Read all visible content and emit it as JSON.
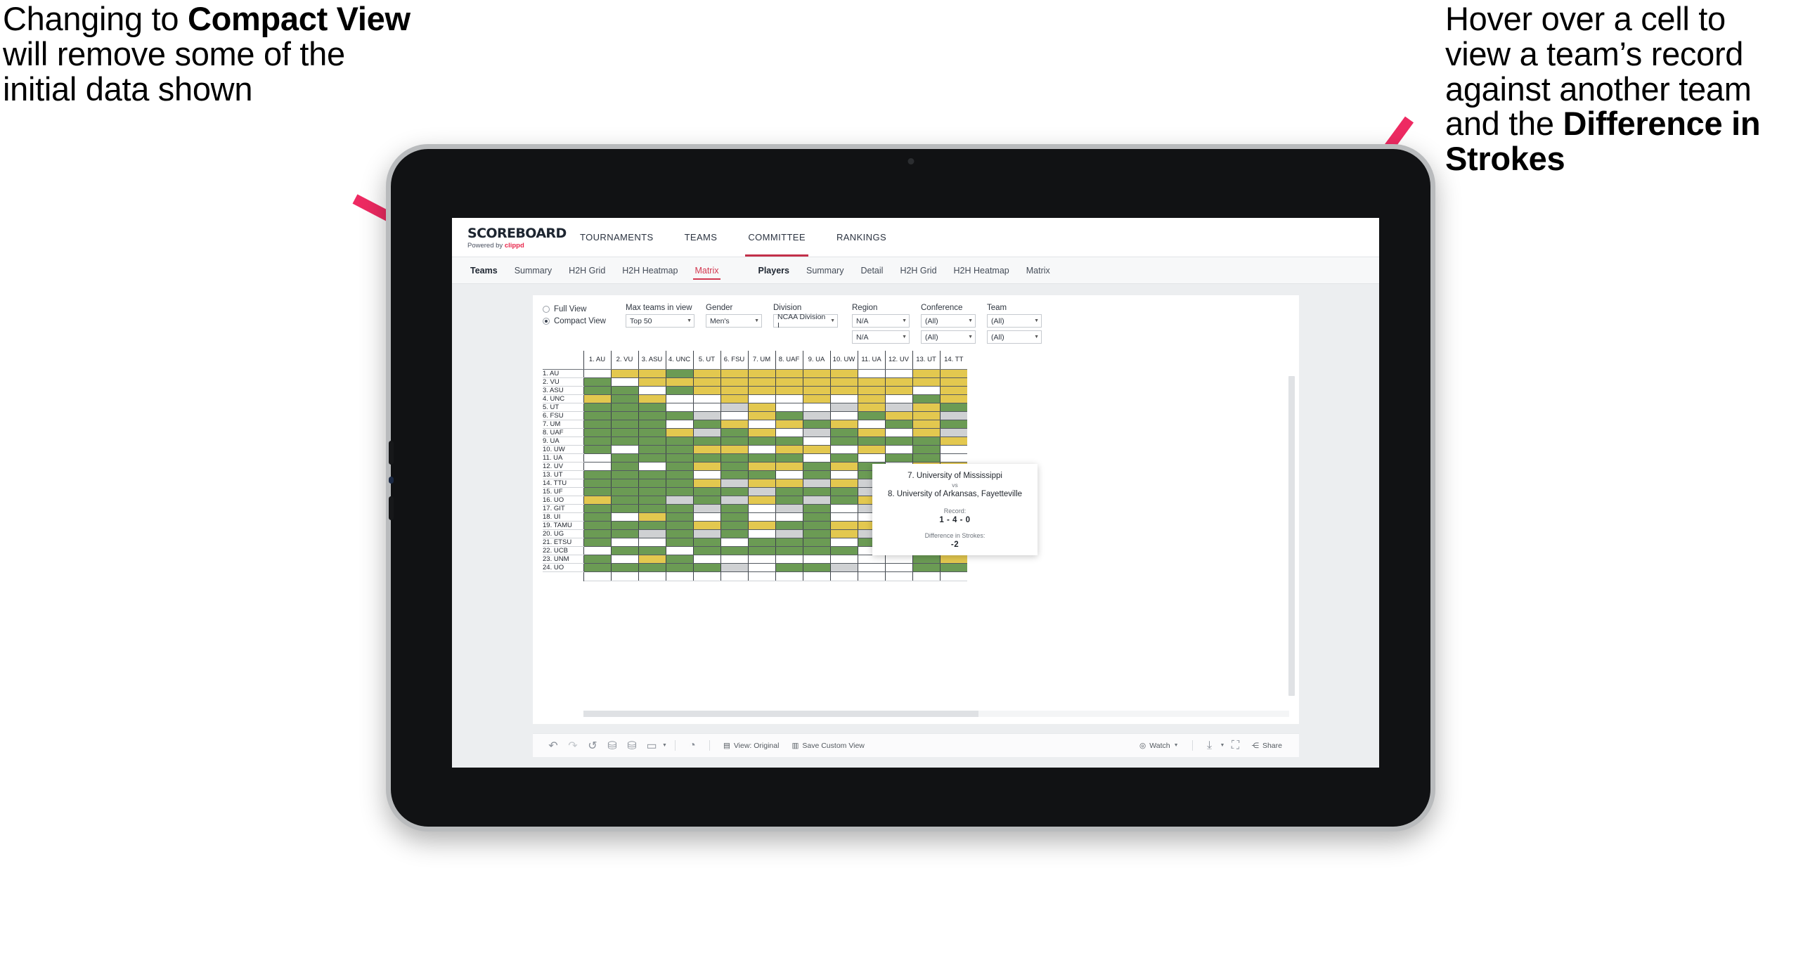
{
  "annotations": {
    "left": {
      "part1": "Changing to ",
      "bold": "Compact View",
      "part2": " will remove some of the initial data shown"
    },
    "right": {
      "part1": "Hover over a cell to view a team’s record against another team and the ",
      "bold": "Difference in Strokes",
      "part2": ""
    },
    "arrow_color": "#ee2a62"
  },
  "app": {
    "brand": {
      "title": "SCOREBOARD",
      "powered_prefix": "Powered by ",
      "powered_name": "clippd"
    },
    "topnav": [
      {
        "label": "TOURNAMENTS",
        "active": false
      },
      {
        "label": "TEAMS",
        "active": false
      },
      {
        "label": "COMMITTEE",
        "active": true
      },
      {
        "label": "RANKINGS",
        "active": false
      }
    ],
    "subnav": {
      "teams_label": "Teams",
      "teams_items": [
        {
          "label": "Summary",
          "active": false
        },
        {
          "label": "H2H Grid",
          "active": false
        },
        {
          "label": "H2H Heatmap",
          "active": false
        },
        {
          "label": "Matrix",
          "active": true
        }
      ],
      "players_label": "Players",
      "players_items": [
        {
          "label": "Summary",
          "active": false
        },
        {
          "label": "Detail",
          "active": false
        },
        {
          "label": "H2H Grid",
          "active": false
        },
        {
          "label": "H2H Heatmap",
          "active": false
        },
        {
          "label": "Matrix",
          "active": false
        }
      ]
    },
    "filters": {
      "view_options": [
        {
          "label": "Full View",
          "selected": false
        },
        {
          "label": "Compact View",
          "selected": true
        }
      ],
      "max_teams": {
        "label": "Max teams in view",
        "value": "Top 50"
      },
      "gender": {
        "label": "Gender",
        "value": "Men's"
      },
      "division": {
        "label": "Division",
        "value": "NCAA Division I"
      },
      "region": {
        "label": "Region",
        "value1": "N/A",
        "value2": "N/A"
      },
      "conference": {
        "label": "Conference",
        "value1": "(All)",
        "value2": "(All)"
      },
      "team": {
        "label": "Team",
        "value1": "(All)",
        "value2": "(All)"
      }
    },
    "tooltip": {
      "team_a": "7. University of Mississippi",
      "vs": "vs",
      "team_b": "8. University of Arkansas, Fayetteville",
      "record_label": "Record:",
      "record_value": "1 - 4 - 0",
      "diff_label": "Difference in Strokes:",
      "diff_value": "-2"
    },
    "toolbar": {
      "icons": [
        {
          "name": "undo-icon",
          "glyph": "↶",
          "dim": false
        },
        {
          "name": "redo-icon",
          "glyph": "↷",
          "dim": true
        },
        {
          "name": "revert-icon",
          "glyph": "↺",
          "dim": false
        },
        {
          "name": "refresh-data-icon",
          "glyph": "⛁",
          "dim": false
        },
        {
          "name": "pause-refresh-icon",
          "glyph": "⛁",
          "dim": false
        },
        {
          "name": "highlight-icon",
          "glyph": "▭",
          "dim": false
        }
      ],
      "clock_icon": "◴",
      "view_original_label": "View: Original",
      "save_custom_view_label": "Save Custom View",
      "watch_label": "Watch",
      "share_label": "Share"
    }
  },
  "chart_data": {
    "type": "heatmap",
    "title": "Head-to-Head Team Matrix",
    "legend": {
      "win": "#6b9b54",
      "loss": "#e3c84f",
      "tie": "#cfd1d3",
      "none": "#ffffff"
    },
    "columns": [
      "1. AU",
      "2. VU",
      "3. ASU",
      "4. UNC",
      "5. UT",
      "6. FSU",
      "7. UM",
      "8. UAF",
      "9. UA",
      "10. UW",
      "11. UA",
      "12. UV",
      "13. UT",
      "14. TT"
    ],
    "rows": [
      "1. AU",
      "2. VU",
      "3. ASU",
      "4. UNC",
      "5. UT",
      "6. FSU",
      "7. UM",
      "8. UAF",
      "9. UA",
      "10. UW",
      "11. UA",
      "12. UV",
      "13. UT",
      "14. TTU",
      "15. UF",
      "16. UO",
      "17. GIT",
      "18. UI",
      "19. TAMU",
      "20. UG",
      "21. ETSU",
      "22. UCB",
      "23. UNM",
      "24. UO"
    ],
    "cells": [
      [
        "w",
        "y",
        "y",
        "g",
        "y",
        "y",
        "y",
        "y",
        "y",
        "y",
        "w",
        "w",
        "y",
        "y"
      ],
      [
        "g",
        "w",
        "y",
        "y",
        "y",
        "y",
        "y",
        "y",
        "y",
        "y",
        "y",
        "y",
        "y",
        "y"
      ],
      [
        "g",
        "g",
        "w",
        "g",
        "y",
        "y",
        "y",
        "y",
        "y",
        "y",
        "y",
        "y",
        "w",
        "y"
      ],
      [
        "y",
        "g",
        "y",
        "w",
        "w",
        "y",
        "w",
        "w",
        "y",
        "w",
        "y",
        "w",
        "g",
        "y"
      ],
      [
        "g",
        "g",
        "g",
        "w",
        "w",
        "s",
        "y",
        "w",
        "w",
        "s",
        "y",
        "s",
        "y",
        "g"
      ],
      [
        "g",
        "g",
        "g",
        "g",
        "s",
        "w",
        "y",
        "g",
        "s",
        "w",
        "g",
        "y",
        "y",
        "s"
      ],
      [
        "g",
        "g",
        "g",
        "w",
        "g",
        "y",
        "w",
        "y",
        "g",
        "y",
        "w",
        "g",
        "y",
        "g"
      ],
      [
        "g",
        "g",
        "g",
        "y",
        "s",
        "g",
        "y",
        "w",
        "s",
        "g",
        "y",
        "w",
        "y",
        "s"
      ],
      [
        "g",
        "g",
        "g",
        "g",
        "g",
        "g",
        "g",
        "g",
        "w",
        "g",
        "g",
        "g",
        "g",
        "y"
      ],
      [
        "g",
        "w",
        "g",
        "g",
        "y",
        "y",
        "w",
        "y",
        "y",
        "w",
        "y",
        "w",
        "g",
        "w"
      ],
      [
        "w",
        "g",
        "g",
        "g",
        "g",
        "g",
        "g",
        "g",
        "w",
        "g",
        "w",
        "g",
        "g",
        "w"
      ],
      [
        "w",
        "g",
        "w",
        "g",
        "y",
        "g",
        "y",
        "y",
        "g",
        "y",
        "g",
        "w",
        "y",
        "y"
      ],
      [
        "g",
        "g",
        "g",
        "g",
        "w",
        "g",
        "g",
        "w",
        "g",
        "w",
        "g",
        "w",
        "w",
        "s"
      ],
      [
        "g",
        "g",
        "g",
        "g",
        "y",
        "s",
        "y",
        "y",
        "s",
        "y",
        "s",
        "y",
        "s",
        "w"
      ],
      [
        "g",
        "g",
        "g",
        "g",
        "g",
        "g",
        "s",
        "g",
        "g",
        "g",
        "s",
        "g",
        "y",
        "y"
      ],
      [
        "y",
        "g",
        "g",
        "s",
        "g",
        "s",
        "y",
        "g",
        "s",
        "g",
        "y",
        "s",
        "g",
        "w"
      ],
      [
        "g",
        "g",
        "g",
        "g",
        "s",
        "g",
        "w",
        "s",
        "g",
        "w",
        "s",
        "g",
        "g",
        "w"
      ],
      [
        "g",
        "w",
        "y",
        "g",
        "w",
        "g",
        "w",
        "w",
        "g",
        "w",
        "w",
        "g",
        "y",
        "w"
      ],
      [
        "g",
        "g",
        "g",
        "g",
        "y",
        "g",
        "y",
        "g",
        "g",
        "y",
        "y",
        "g",
        "g",
        "w"
      ],
      [
        "g",
        "g",
        "s",
        "g",
        "s",
        "g",
        "w",
        "s",
        "g",
        "y",
        "s",
        "g",
        "g",
        "w"
      ],
      [
        "g",
        "w",
        "w",
        "g",
        "g",
        "w",
        "g",
        "g",
        "g",
        "w",
        "g",
        "w",
        "w",
        "y"
      ],
      [
        "w",
        "g",
        "g",
        "w",
        "g",
        "g",
        "g",
        "g",
        "g",
        "g",
        "w",
        "w",
        "w",
        "g"
      ],
      [
        "g",
        "w",
        "y",
        "g",
        "w",
        "w",
        "w",
        "w",
        "w",
        "w",
        "w",
        "w",
        "g",
        "y"
      ],
      [
        "g",
        "g",
        "g",
        "g",
        "g",
        "s",
        "w",
        "g",
        "g",
        "s",
        "w",
        "w",
        "g",
        "g"
      ]
    ]
  }
}
